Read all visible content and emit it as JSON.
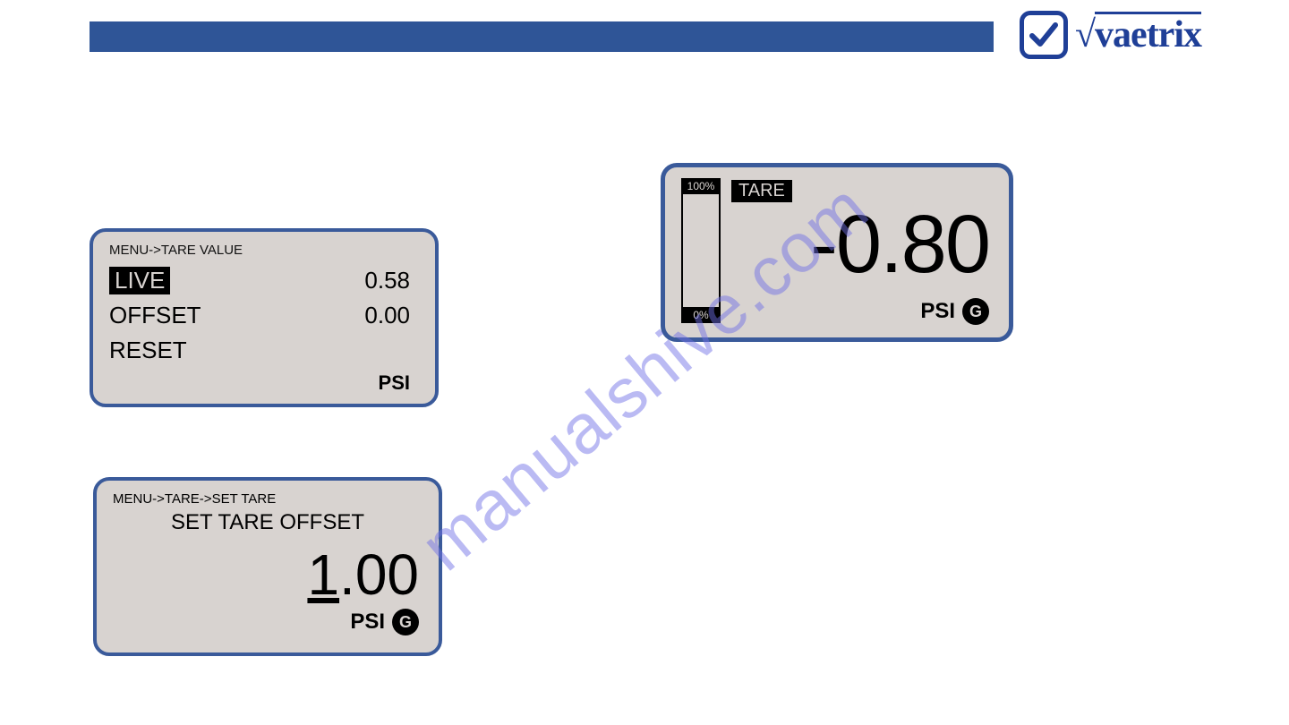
{
  "brand": {
    "name": "vaetrix"
  },
  "panel_tare_value": {
    "breadcrumb": "MENU->TARE VALUE",
    "rows": {
      "live": {
        "label": "LIVE",
        "value": "0.58"
      },
      "offset": {
        "label": "OFFSET",
        "value": "0.00"
      },
      "reset": {
        "label": "RESET"
      }
    },
    "unit": "PSI"
  },
  "panel_display": {
    "bar": {
      "top_label": "100%",
      "bottom_label": "0%"
    },
    "tare_chip": "TARE",
    "reading": "-0.80",
    "unit": "PSI",
    "gauge_badge": "G"
  },
  "panel_set_tare": {
    "breadcrumb": "MENU->TARE->SET TARE",
    "title": "SET TARE OFFSET",
    "value_leading": "1",
    "value_rest": ".00",
    "unit": "PSI",
    "gauge_badge": "G"
  },
  "watermark": "manualshive.com"
}
